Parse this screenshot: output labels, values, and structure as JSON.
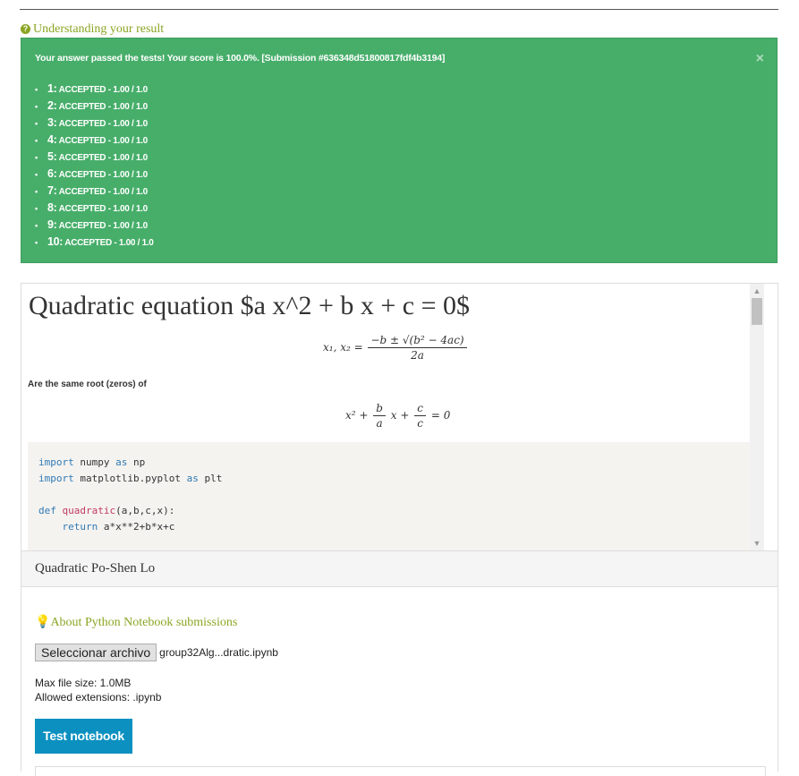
{
  "understanding_link": "Understanding your result",
  "result": {
    "message": "Your answer passed the tests! Your score is 100.0%. [Submission #636348d51800817fdf4b3194]",
    "close": "×",
    "tests": [
      {
        "num": "1:",
        "result": "ACCEPTED - 1.00 / 1.0"
      },
      {
        "num": "2:",
        "result": "ACCEPTED - 1.00 / 1.0"
      },
      {
        "num": "3:",
        "result": "ACCEPTED - 1.00 / 1.0"
      },
      {
        "num": "4:",
        "result": "ACCEPTED - 1.00 / 1.0"
      },
      {
        "num": "5:",
        "result": "ACCEPTED - 1.00 / 1.0"
      },
      {
        "num": "6:",
        "result": "ACCEPTED - 1.00 / 1.0"
      },
      {
        "num": "7:",
        "result": "ACCEPTED - 1.00 / 1.0"
      },
      {
        "num": "8:",
        "result": "ACCEPTED - 1.00 / 1.0"
      },
      {
        "num": "9:",
        "result": "ACCEPTED - 1.00 / 1.0"
      },
      {
        "num": "10:",
        "result": "ACCEPTED - 1.00 / 1.0"
      }
    ]
  },
  "statement": {
    "title": "Quadratic equation $a x^2 + b x + c = 0$",
    "formula1_lhs": "x₁, x₂ =",
    "formula1_num": "−b ± √(b² − 4ac)",
    "formula1_den": "2a",
    "same_root": "Are the same root (zeros) of",
    "formula2_start": "x² +",
    "formula2_b": "b",
    "formula2_a": "a",
    "formula2_mid": "x +",
    "formula2_c1": "c",
    "formula2_c2": "c",
    "formula2_end": "= 0",
    "code": {
      "import": "import",
      "as": "as",
      "numpy": " numpy ",
      "np": " np",
      "matplotlib": " matplotlib.pyplot ",
      "plt": " plt",
      "def": "def",
      "fname": "quadratic",
      "args": "(a,b,c,x):",
      "indent_return": "    return",
      "expr": " a*x**2+b*x+c"
    }
  },
  "task_title": "Quadratic Po-Shen Lo",
  "about_link": "About Python Notebook submissions",
  "file_button": "Seleccionar archivo",
  "file_name": "group32Alg...dratic.ipynb",
  "max_size": "Max file size: 1.0MB",
  "extensions": "Allowed extensions: .ipynb",
  "test_button": "Test notebook",
  "colors": {
    "success": "#47ae6a",
    "accent": "#8aa523",
    "button": "#0b90c0"
  }
}
